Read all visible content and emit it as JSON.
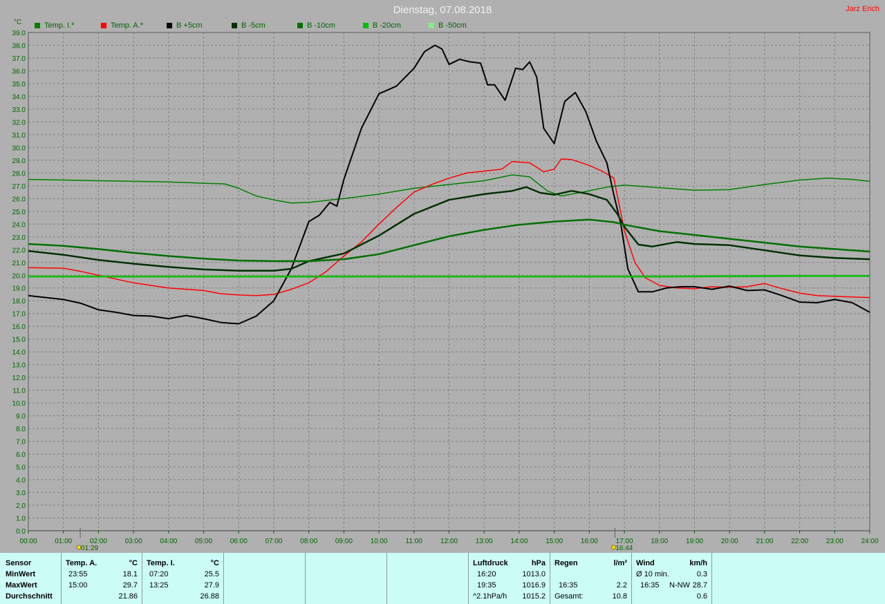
{
  "header": {
    "title": "Dienstag, 07.08.2018",
    "author": "Jarz Erich",
    "y_unit": "°C"
  },
  "colors": {
    "background": "#b0b0b0",
    "axis_text": "#006400",
    "grid": "#808080",
    "panel_bg": "#ccfcf6"
  },
  "chart_data": {
    "type": "line",
    "title": "Dienstag, 07.08.2018",
    "ylabel": "°C",
    "xlabel": "",
    "ylim": [
      0,
      39
    ],
    "xlim": [
      0,
      24
    ],
    "grid": true,
    "legend_position": "top",
    "x_ticks": [
      "00:00",
      "01:00",
      "02:00",
      "03:00",
      "04:00",
      "05:00",
      "06:00",
      "07:00",
      "08:00",
      "09:00",
      "10:00",
      "11:00",
      "12:00",
      "13:00",
      "14:00",
      "15:00",
      "16:00",
      "17:00",
      "18:00",
      "19:00",
      "20:00",
      "21:00",
      "22:00",
      "23:00",
      "24:00"
    ],
    "y_ticks": [
      "0.0",
      "1.0",
      "2.0",
      "3.0",
      "4.0",
      "5.0",
      "6.0",
      "7.0",
      "8.0",
      "9.0",
      "10.0",
      "11.0",
      "12.0",
      "13.0",
      "14.0",
      "15.0",
      "16.0",
      "17.0",
      "18.0",
      "19.0",
      "20.0",
      "21.0",
      "22.0",
      "23.0",
      "24.0",
      "25.0",
      "26.0",
      "27.0",
      "28.0",
      "29.0",
      "30.0",
      "31.0",
      "32.0",
      "33.0",
      "34.0",
      "35.0",
      "36.0",
      "37.0",
      "38.0",
      "39.0"
    ],
    "markers": [
      {
        "x": 1.48,
        "label": "01:29"
      },
      {
        "x": 16.73,
        "label": "16:44"
      }
    ],
    "series": [
      {
        "name": "Temp. I.*",
        "color": "#008000",
        "width": 1.5,
        "points": [
          [
            0,
            27.5
          ],
          [
            1,
            27.45
          ],
          [
            2,
            27.4
          ],
          [
            3,
            27.35
          ],
          [
            4,
            27.3
          ],
          [
            5,
            27.2
          ],
          [
            5.6,
            27.15
          ],
          [
            6,
            26.8
          ],
          [
            6.5,
            26.2
          ],
          [
            7,
            25.9
          ],
          [
            7.5,
            25.65
          ],
          [
            8,
            25.7
          ],
          [
            9,
            26
          ],
          [
            10,
            26.35
          ],
          [
            11,
            26.8
          ],
          [
            12,
            27.1
          ],
          [
            13,
            27.4
          ],
          [
            13.8,
            27.85
          ],
          [
            14.3,
            27.7
          ],
          [
            14.8,
            26.6
          ],
          [
            15.2,
            26.2
          ],
          [
            15.8,
            26.5
          ],
          [
            16.5,
            26.9
          ],
          [
            17,
            27.05
          ],
          [
            18,
            26.85
          ],
          [
            19,
            26.65
          ],
          [
            20,
            26.7
          ],
          [
            21,
            27.1
          ],
          [
            22,
            27.45
          ],
          [
            22.8,
            27.6
          ],
          [
            23.5,
            27.5
          ],
          [
            24,
            27.35
          ]
        ]
      },
      {
        "name": "Temp. A.*",
        "color": "#ff0000",
        "width": 1.5,
        "points": [
          [
            0,
            20.6
          ],
          [
            1,
            20.55
          ],
          [
            1.5,
            20.3
          ],
          [
            2,
            20
          ],
          [
            2.5,
            19.7
          ],
          [
            3,
            19.4
          ],
          [
            4,
            19
          ],
          [
            5,
            18.8
          ],
          [
            5.5,
            18.55
          ],
          [
            6,
            18.45
          ],
          [
            6.5,
            18.4
          ],
          [
            7,
            18.5
          ],
          [
            7.5,
            18.9
          ],
          [
            8,
            19.4
          ],
          [
            8.5,
            20.3
          ],
          [
            9,
            21.5
          ],
          [
            9.5,
            22.6
          ],
          [
            10,
            24
          ],
          [
            10.5,
            25.3
          ],
          [
            11,
            26.5
          ],
          [
            11.5,
            27.1
          ],
          [
            12,
            27.6
          ],
          [
            12.5,
            28
          ],
          [
            13,
            28.15
          ],
          [
            13.5,
            28.3
          ],
          [
            13.8,
            28.9
          ],
          [
            14.3,
            28.8
          ],
          [
            14.7,
            28.1
          ],
          [
            15,
            28.3
          ],
          [
            15.2,
            29.1
          ],
          [
            15.5,
            29.05
          ],
          [
            16,
            28.6
          ],
          [
            16.4,
            28.1
          ],
          [
            16.7,
            27.6
          ],
          [
            17,
            23.5
          ],
          [
            17.3,
            21
          ],
          [
            17.6,
            19.8
          ],
          [
            18,
            19.2
          ],
          [
            18.5,
            19
          ],
          [
            19,
            18.95
          ],
          [
            19.5,
            19.1
          ],
          [
            20,
            19.05
          ],
          [
            20.5,
            19.1
          ],
          [
            21,
            19.35
          ],
          [
            21.5,
            18.95
          ],
          [
            22,
            18.6
          ],
          [
            22.5,
            18.4
          ],
          [
            23,
            18.35
          ],
          [
            23.5,
            18.3
          ],
          [
            24,
            18.25
          ]
        ]
      },
      {
        "name": "B +5cm",
        "color": "#000000",
        "width": 2,
        "points": [
          [
            0,
            18.4
          ],
          [
            1,
            18.1
          ],
          [
            1.5,
            17.8
          ],
          [
            2,
            17.3
          ],
          [
            2.5,
            17.1
          ],
          [
            3,
            16.85
          ],
          [
            3.5,
            16.8
          ],
          [
            4,
            16.6
          ],
          [
            4.5,
            16.85
          ],
          [
            5,
            16.6
          ],
          [
            5.5,
            16.3
          ],
          [
            6,
            16.2
          ],
          [
            6.5,
            16.8
          ],
          [
            7,
            18
          ],
          [
            7.5,
            20.5
          ],
          [
            8,
            24.2
          ],
          [
            8.3,
            24.7
          ],
          [
            8.6,
            25.7
          ],
          [
            8.8,
            25.4
          ],
          [
            9,
            27.5
          ],
          [
            9.5,
            31.5
          ],
          [
            10,
            34.2
          ],
          [
            10.5,
            34.8
          ],
          [
            11,
            36.2
          ],
          [
            11.3,
            37.5
          ],
          [
            11.6,
            38
          ],
          [
            11.8,
            37.7
          ],
          [
            12,
            36.5
          ],
          [
            12.3,
            36.9
          ],
          [
            12.6,
            36.7
          ],
          [
            12.9,
            36.6
          ],
          [
            13.1,
            34.9
          ],
          [
            13.3,
            34.9
          ],
          [
            13.6,
            33.7
          ],
          [
            13.9,
            36.2
          ],
          [
            14.1,
            36.1
          ],
          [
            14.3,
            36.7
          ],
          [
            14.5,
            35.5
          ],
          [
            14.7,
            31.5
          ],
          [
            15,
            30.3
          ],
          [
            15.3,
            33.6
          ],
          [
            15.6,
            34.3
          ],
          [
            15.9,
            32.8
          ],
          [
            16.2,
            30.5
          ],
          [
            16.5,
            28.8
          ],
          [
            16.7,
            26.3
          ],
          [
            16.9,
            24
          ],
          [
            17.1,
            20.5
          ],
          [
            17.4,
            18.7
          ],
          [
            17.8,
            18.7
          ],
          [
            18.2,
            19
          ],
          [
            18.6,
            19.1
          ],
          [
            19,
            19.1
          ],
          [
            19.5,
            18.9
          ],
          [
            20,
            19.15
          ],
          [
            20.5,
            18.8
          ],
          [
            21,
            18.85
          ],
          [
            21.5,
            18.4
          ],
          [
            22,
            17.9
          ],
          [
            22.5,
            17.85
          ],
          [
            23,
            18.1
          ],
          [
            23.5,
            17.85
          ],
          [
            24,
            17.1
          ]
        ]
      },
      {
        "name": "B -5cm",
        "color": "#003000",
        "width": 2.5,
        "points": [
          [
            0,
            21.9
          ],
          [
            1,
            21.6
          ],
          [
            2,
            21.2
          ],
          [
            3,
            20.9
          ],
          [
            4,
            20.65
          ],
          [
            5,
            20.45
          ],
          [
            6,
            20.35
          ],
          [
            7,
            20.35
          ],
          [
            7.5,
            20.5
          ],
          [
            8,
            21.1
          ],
          [
            9,
            21.7
          ],
          [
            10,
            23.1
          ],
          [
            11,
            24.8
          ],
          [
            12,
            25.9
          ],
          [
            13,
            26.35
          ],
          [
            13.8,
            26.6
          ],
          [
            14.2,
            26.9
          ],
          [
            14.6,
            26.45
          ],
          [
            15,
            26.3
          ],
          [
            15.5,
            26.6
          ],
          [
            16,
            26.35
          ],
          [
            16.5,
            25.9
          ],
          [
            16.8,
            24.8
          ],
          [
            17,
            23.8
          ],
          [
            17.4,
            22.4
          ],
          [
            17.8,
            22.25
          ],
          [
            18.5,
            22.6
          ],
          [
            19,
            22.45
          ],
          [
            20,
            22.35
          ],
          [
            21,
            21.95
          ],
          [
            22,
            21.55
          ],
          [
            23,
            21.35
          ],
          [
            24,
            21.25
          ]
        ]
      },
      {
        "name": "B -10cm",
        "color": "#007000",
        "width": 2.5,
        "points": [
          [
            0,
            22.45
          ],
          [
            1,
            22.3
          ],
          [
            2,
            22.05
          ],
          [
            3,
            21.75
          ],
          [
            4,
            21.5
          ],
          [
            5,
            21.3
          ],
          [
            6,
            21.15
          ],
          [
            7,
            21.1
          ],
          [
            8,
            21.1
          ],
          [
            9,
            21.25
          ],
          [
            10,
            21.65
          ],
          [
            11,
            22.35
          ],
          [
            12,
            23.05
          ],
          [
            13,
            23.55
          ],
          [
            14,
            23.95
          ],
          [
            15,
            24.2
          ],
          [
            16,
            24.35
          ],
          [
            16.7,
            24.15
          ],
          [
            17,
            23.95
          ],
          [
            17.5,
            23.7
          ],
          [
            18,
            23.45
          ],
          [
            19,
            23.15
          ],
          [
            20,
            22.85
          ],
          [
            21,
            22.55
          ],
          [
            22,
            22.25
          ],
          [
            23,
            22.05
          ],
          [
            24,
            21.85
          ]
        ]
      },
      {
        "name": "B -20cm",
        "color": "#00c000",
        "width": 2.5,
        "points": [
          [
            0,
            19.9
          ],
          [
            2,
            19.9
          ],
          [
            4,
            19.9
          ],
          [
            6,
            19.9
          ],
          [
            8,
            19.9
          ],
          [
            10,
            19.9
          ],
          [
            12,
            19.9
          ],
          [
            14,
            19.9
          ],
          [
            16,
            19.9
          ],
          [
            18,
            19.9
          ],
          [
            20,
            19.92
          ],
          [
            22,
            19.95
          ],
          [
            24,
            19.95
          ]
        ]
      },
      {
        "name": "B -50cm",
        "color": "#80f080",
        "width": 1.5,
        "points": []
      }
    ]
  },
  "panel": {
    "sensor": {
      "label": "Sensor",
      "min": "MinWert",
      "max": "MaxWert",
      "avg": "Durchschnitt"
    },
    "temp_a": {
      "header": "Temp. A.",
      "unit": "°C",
      "min_time": "23:55",
      "min_val": "18.1",
      "max_time": "15:00",
      "max_val": "29.7",
      "avg_val": "21.86"
    },
    "temp_i": {
      "header": "Temp. I.",
      "unit": "°C",
      "min_time": "07:20",
      "min_val": "25.5",
      "max_time": "13:25",
      "max_val": "27.9",
      "avg_val": "26.88"
    },
    "pressure": {
      "header": "Luftdruck",
      "unit": "hPa",
      "min_time": "16:20",
      "min_val": "1013.0",
      "max_time": "19:35",
      "max_val": "1016.9",
      "trend_label": "^2.1hPa/h",
      "trend_val": "1015.2"
    },
    "rain": {
      "header": "Regen",
      "unit": "l/m²",
      "max_time": "16:35",
      "max_val": "2.2",
      "total_label": "Gesamt:",
      "total_val": "10.8"
    },
    "wind": {
      "header": "Wind",
      "unit": "km/h",
      "avg_label": "Ø 10 min.",
      "avg_val": "0.3",
      "max_time": "16:35",
      "max_dir": "N-NW",
      "max_val": "28.7",
      "last_val": "0.6"
    }
  }
}
